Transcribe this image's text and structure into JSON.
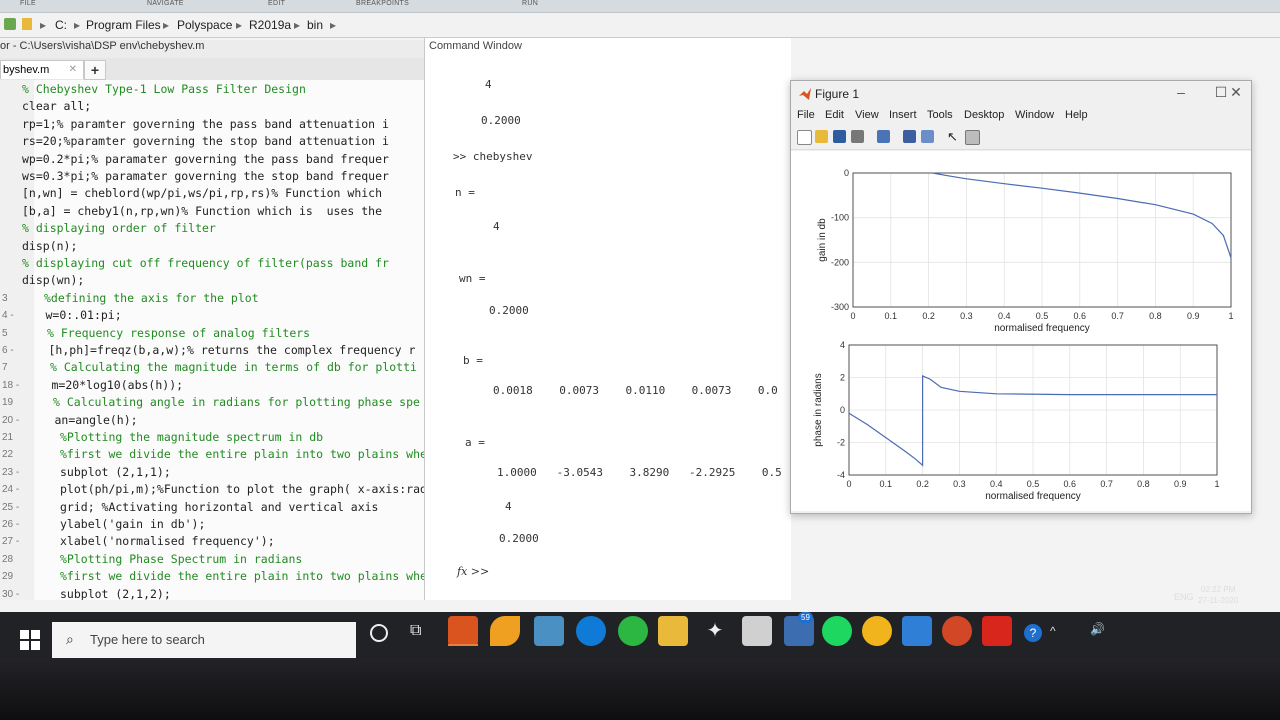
{
  "toolstrip": {
    "tabs": [
      "FILE",
      "NAVIGATE",
      "EDIT",
      "BREAKPOINTS",
      "RUN"
    ]
  },
  "address": {
    "crumbs": [
      "C:",
      "Program Files",
      "Polyspace",
      "R2019a",
      "bin"
    ]
  },
  "editor": {
    "title": "or - C:\\Users\\visha\\DSP env\\chebyshev.m",
    "tab_label": "byshev.m",
    "lines": [
      {
        "n": "",
        "text": "% Chebyshev Type-1 Low Pass Filter Design"
      },
      {
        "n": "",
        "text": "clear all;"
      },
      {
        "n": "",
        "text": "rp=1;% paramter governing the pass band attenuation i"
      },
      {
        "n": "",
        "text": "rs=20;%paramter governing the stop band attenuation i"
      },
      {
        "n": "",
        "text": "wp=0.2*pi;% paramater governing the pass band frequer"
      },
      {
        "n": "",
        "text": "ws=0.3*pi;% paramater governing the stop band frequer"
      },
      {
        "n": "",
        "text": "[n,wn] = cheblord(wp/pi,ws/pi,rp,rs)% Function which"
      },
      {
        "n": "",
        "text": "[b,a] = cheby1(n,rp,wn)% Function which is  uses the"
      },
      {
        "n": "",
        "text": "% displaying order of filter"
      },
      {
        "n": "",
        "text": "disp(n);"
      },
      {
        "n": "",
        "text": "% displaying cut off frequency of filter(pass band fr"
      },
      {
        "n": "",
        "text": "disp(wn);"
      },
      {
        "n": "3",
        "text": "%defining the axis for the plot"
      },
      {
        "n": "4 -",
        "text": "w=0:.01:pi;"
      },
      {
        "n": "5",
        "text": "% Frequency response of analog filters"
      },
      {
        "n": "6 -",
        "text": "[h,ph]=freqz(b,a,w);% returns the complex frequency r"
      },
      {
        "n": "7",
        "text": "% Calculating the magnitude in terms of db for plotti"
      },
      {
        "n": "18 -",
        "text": "m=20*log10(abs(h));"
      },
      {
        "n": "19",
        "text": "% Calculating angle in radians for plotting phase spe"
      },
      {
        "n": "20 -",
        "text": "an=angle(h);"
      },
      {
        "n": "21",
        "text": "%Plotting the magnitude spectrum in db"
      },
      {
        "n": "22",
        "text": "%first we divide the entire plain into two plains whe"
      },
      {
        "n": "23 -",
        "text": "subplot (2,1,1);"
      },
      {
        "n": "24 -",
        "text": "plot(ph/pi,m);%Function to plot the graph( x-axis:rad"
      },
      {
        "n": "25 -",
        "text": "grid; %Activating horizontal and vertical axis"
      },
      {
        "n": "26 -",
        "text": "ylabel('gain in db');"
      },
      {
        "n": "27 -",
        "text": "xlabel('normalised frequency');"
      },
      {
        "n": "28",
        "text": "%Plotting Phase Spectrum in radians"
      },
      {
        "n": "29",
        "text": "%first we divide the entire plain into two plains whe"
      },
      {
        "n": "30 -",
        "text": "subplot (2,1,2);"
      }
    ]
  },
  "command_window": {
    "title": "Command Window",
    "lines": [
      {
        "text": "4"
      },
      {
        "text": "0.2000"
      },
      {
        "text": ">> chebyshev"
      },
      {
        "text": "n ="
      },
      {
        "text": "4"
      },
      {
        "text": "wn ="
      },
      {
        "text": "0.2000"
      },
      {
        "text": "b ="
      },
      {
        "text": "0.0018    0.0073    0.0110    0.0073    0.0"
      },
      {
        "text": "a ="
      },
      {
        "text": "1.0000   -3.0543    3.8290   -2.2925    0.5"
      },
      {
        "text": "4"
      },
      {
        "text": "0.2000"
      }
    ],
    "prompt": "fx >>"
  },
  "figure": {
    "title": "Figure 1",
    "menu": [
      "File",
      "Edit",
      "View",
      "Insert",
      "Tools",
      "Desktop",
      "Window",
      "Help"
    ]
  },
  "chart_data": [
    {
      "type": "line",
      "ylabel": "gain in db",
      "xlabel": "normalised frequency",
      "xlim": [
        0,
        1
      ],
      "ylim": [
        -300,
        0
      ],
      "xticks": [
        "0",
        "0.1",
        "0.2",
        "0.3",
        "0.4",
        "0.5",
        "0.6",
        "0.7",
        "0.8",
        "0.9",
        "1"
      ],
      "yticks": [
        "0",
        "-100",
        "-200",
        "-300"
      ],
      "grid": true,
      "color": "#4a6bb3",
      "x": [
        0.21,
        0.25,
        0.3,
        0.4,
        0.5,
        0.6,
        0.7,
        0.8,
        0.9,
        0.95,
        0.98,
        1.0
      ],
      "y": [
        0,
        -6,
        -13,
        -24,
        -34,
        -45,
        -57,
        -71,
        -92,
        -113,
        -140,
        -190
      ]
    },
    {
      "type": "line",
      "ylabel": "phase in radians",
      "xlabel": "normalised frequency",
      "xlim": [
        0,
        1
      ],
      "ylim": [
        -4,
        4
      ],
      "xticks": [
        "0",
        "0.1",
        "0.2",
        "0.3",
        "0.4",
        "0.5",
        "0.6",
        "0.7",
        "0.8",
        "0.9",
        "1"
      ],
      "yticks": [
        "4",
        "2",
        "0",
        "-2",
        "-4"
      ],
      "grid": true,
      "color": "#4a6bb3",
      "x": [
        0.0,
        0.05,
        0.1,
        0.15,
        0.18,
        0.2,
        0.2,
        0.22,
        0.25,
        0.3,
        0.4,
        0.6,
        0.8,
        1.0
      ],
      "y": [
        -0.2,
        -0.9,
        -1.7,
        -2.5,
        -3.0,
        -3.4,
        2.1,
        1.9,
        1.4,
        1.15,
        1.0,
        0.95,
        0.95,
        0.95
      ]
    }
  ],
  "taskbar": {
    "search_placeholder": "Type here to search",
    "language": "ENG",
    "time": "02:22 PM",
    "date": "27-11-2020",
    "mail_badge": "59"
  }
}
